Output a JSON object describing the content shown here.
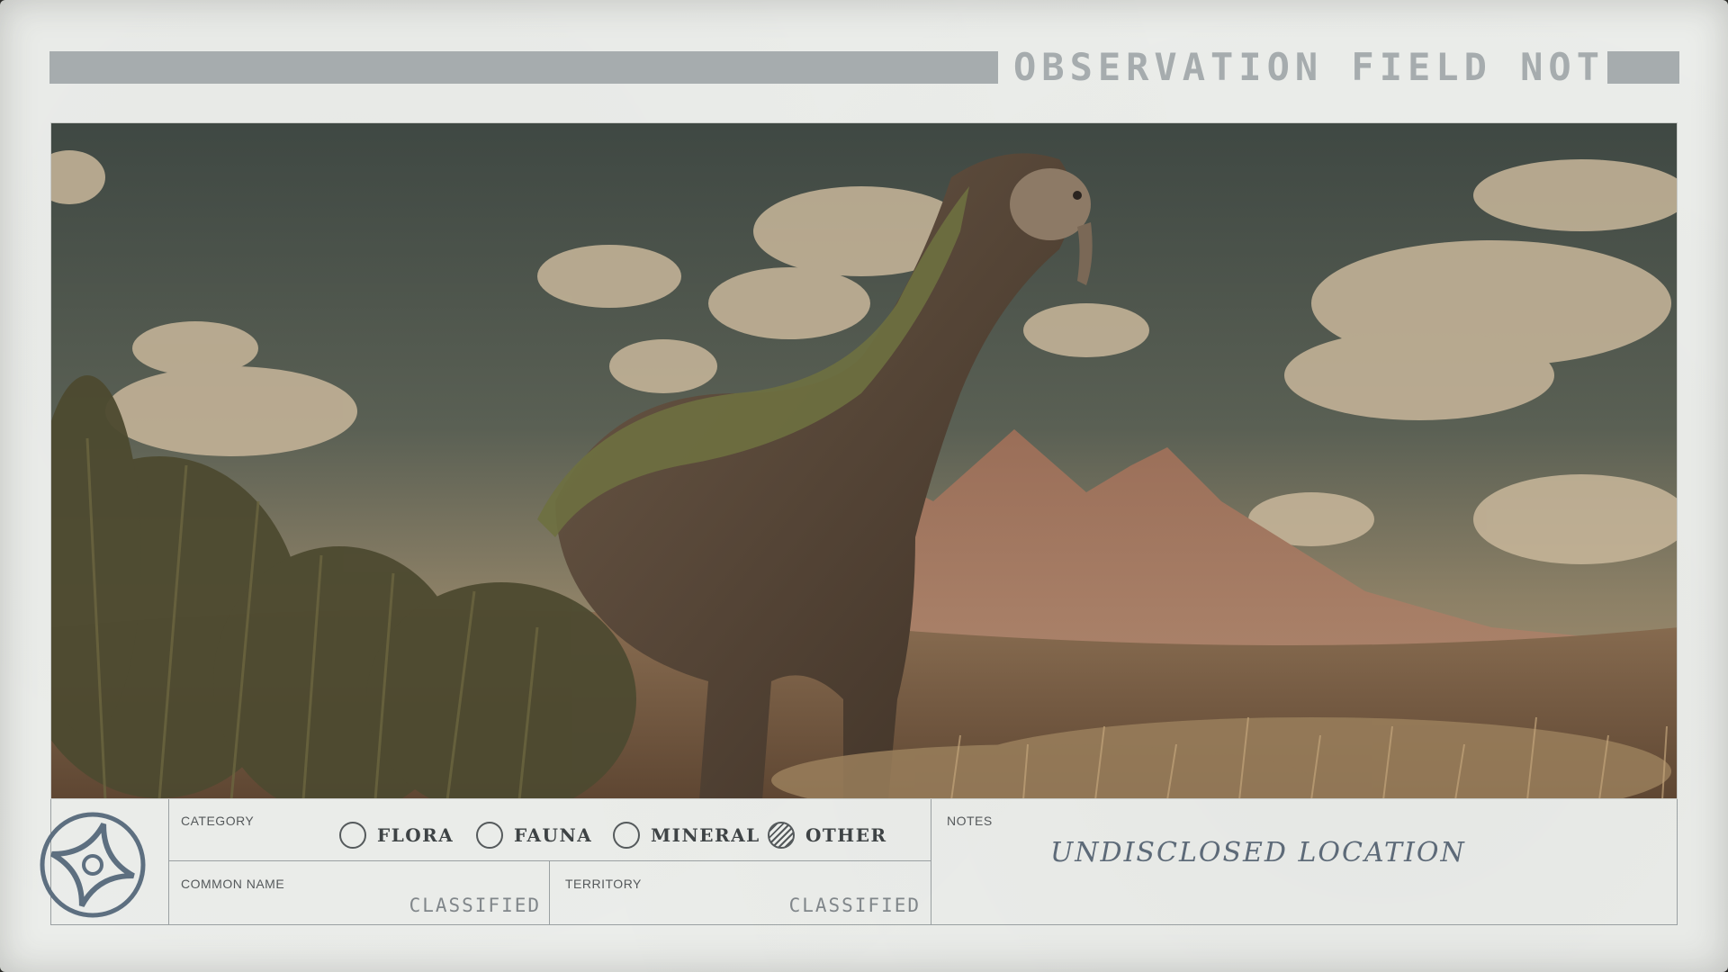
{
  "header": {
    "title": "OBSERVATION FIELD NOTES"
  },
  "photo": {
    "description_icon": "dinosaur-photo"
  },
  "form": {
    "category": {
      "label": "CATEGORY",
      "options": [
        {
          "label": "FLORA",
          "selected": false
        },
        {
          "label": "FAUNA",
          "selected": false
        },
        {
          "label": "MINERAL",
          "selected": false
        },
        {
          "label": "OTHER",
          "selected": true
        }
      ]
    },
    "common_name": {
      "label": "COMMON NAME",
      "value": "CLASSIFIED"
    },
    "territory": {
      "label": "TERRITORY",
      "value": "CLASSIFIED"
    },
    "notes": {
      "label": "NOTES",
      "value": "UNDISCLOSED LOCATION"
    }
  },
  "colors": {
    "paper": "#eceeeb",
    "header_bar": "#a6acae",
    "ink": "#3e4345",
    "notes_ink": "#5d6a78",
    "logo": "#5d6f80"
  },
  "icons": {
    "logo": "star-emblem-icon"
  }
}
